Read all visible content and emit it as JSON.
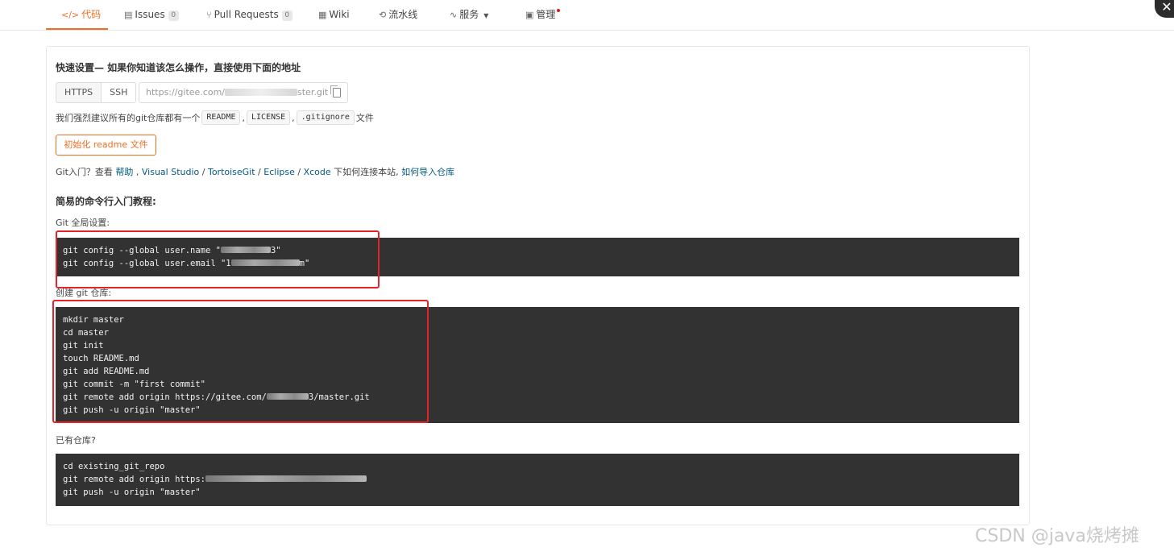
{
  "tabs": [
    {
      "label": "代码",
      "icon": "code-icon",
      "active": true
    },
    {
      "label": "Issues",
      "icon": "issues-icon",
      "badge": "0"
    },
    {
      "label": "Pull Requests",
      "icon": "pull-request-icon",
      "badge": "0"
    },
    {
      "label": "Wiki",
      "icon": "wiki-icon"
    },
    {
      "label": "流水线",
      "icon": "pipeline-icon"
    },
    {
      "label": "服务",
      "icon": "service-icon",
      "caret": true
    },
    {
      "label": "管理",
      "icon": "manage-icon",
      "dot": true
    }
  ],
  "close_label": "✕",
  "quick_setup": {
    "heading": "快速设置— 如果你知道该怎么操作，直接使用下面的地址",
    "https_label": "HTTPS",
    "ssh_label": "SSH",
    "url_prefix": "https://gitee.com/",
    "url_suffix": "ster.git",
    "recommend_prefix": "我们强烈建议所有的git仓库都有一个",
    "chips": [
      "README",
      "LICENSE",
      ".gitignore"
    ],
    "chip_sep": ",",
    "recommend_suffix": "文件",
    "init_button": "初始化 readme 文件",
    "git_intro_prefix": "Git入门？查看 ",
    "help_link": "帮助",
    "sep_comma": " , ",
    "vs_link": "Visual Studio",
    "slash": " / ",
    "tortoise_link": "TortoiseGit",
    "eclipse_link": "Eclipse",
    "xcode_link": "Xcode",
    "git_intro_mid": " 下如何连接本站, ",
    "import_link": "如何导入仓库"
  },
  "tutorial": {
    "heading": "简易的命令行入门教程:",
    "global_label": "Git 全局设置:",
    "global_lines": [
      {
        "pre": "git config --global user.name \"",
        "post": "3\""
      },
      {
        "pre": "git config --global user.email \"",
        "mid": "1",
        "post": "m\""
      }
    ],
    "create_label": "创建 git 仓库:",
    "create_lines": [
      "mkdir master",
      "cd master",
      "git init",
      "touch README.md",
      "git add README.md",
      "git commit -m \"first commit\""
    ],
    "remote_pre": "git remote add origin https://gitee.com/",
    "remote_post": "3/master.git",
    "push_line": "git push -u origin \"master\"",
    "existing_label": "已有仓库?",
    "existing_lines": {
      "cd": "cd existing_git_repo",
      "remote_pre": "git remote add origin https:",
      "push": "git push -u origin \"master\""
    }
  },
  "watermark": "CSDN @java烧烤摊"
}
